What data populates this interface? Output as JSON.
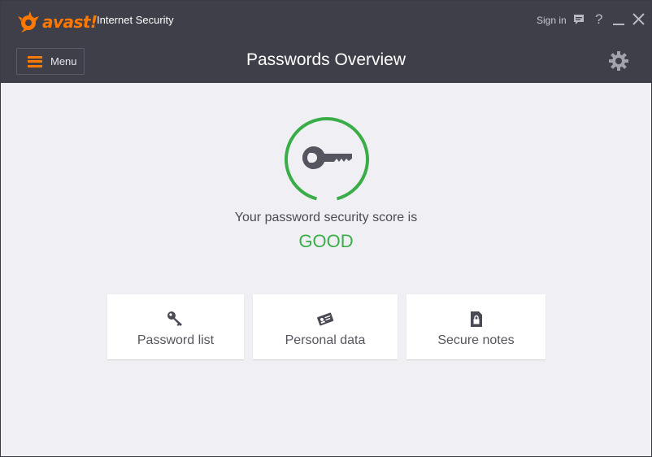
{
  "app": {
    "brand": "avast!",
    "product": "Internet Security",
    "sign_in": "Sign in"
  },
  "toolbar": {
    "menu_label": "Menu",
    "title": "Passwords Overview"
  },
  "score": {
    "caption": "Your password security score is",
    "value": "GOOD"
  },
  "cards": [
    {
      "label": "Password list",
      "icon": "key-icon"
    },
    {
      "label": "Personal data",
      "icon": "id-card-icon"
    },
    {
      "label": "Secure notes",
      "icon": "locked-note-icon"
    }
  ],
  "colors": {
    "header": "#3f3f4a",
    "accent": "#ff7800",
    "good": "#3aad48",
    "background": "#f0f0f4"
  }
}
